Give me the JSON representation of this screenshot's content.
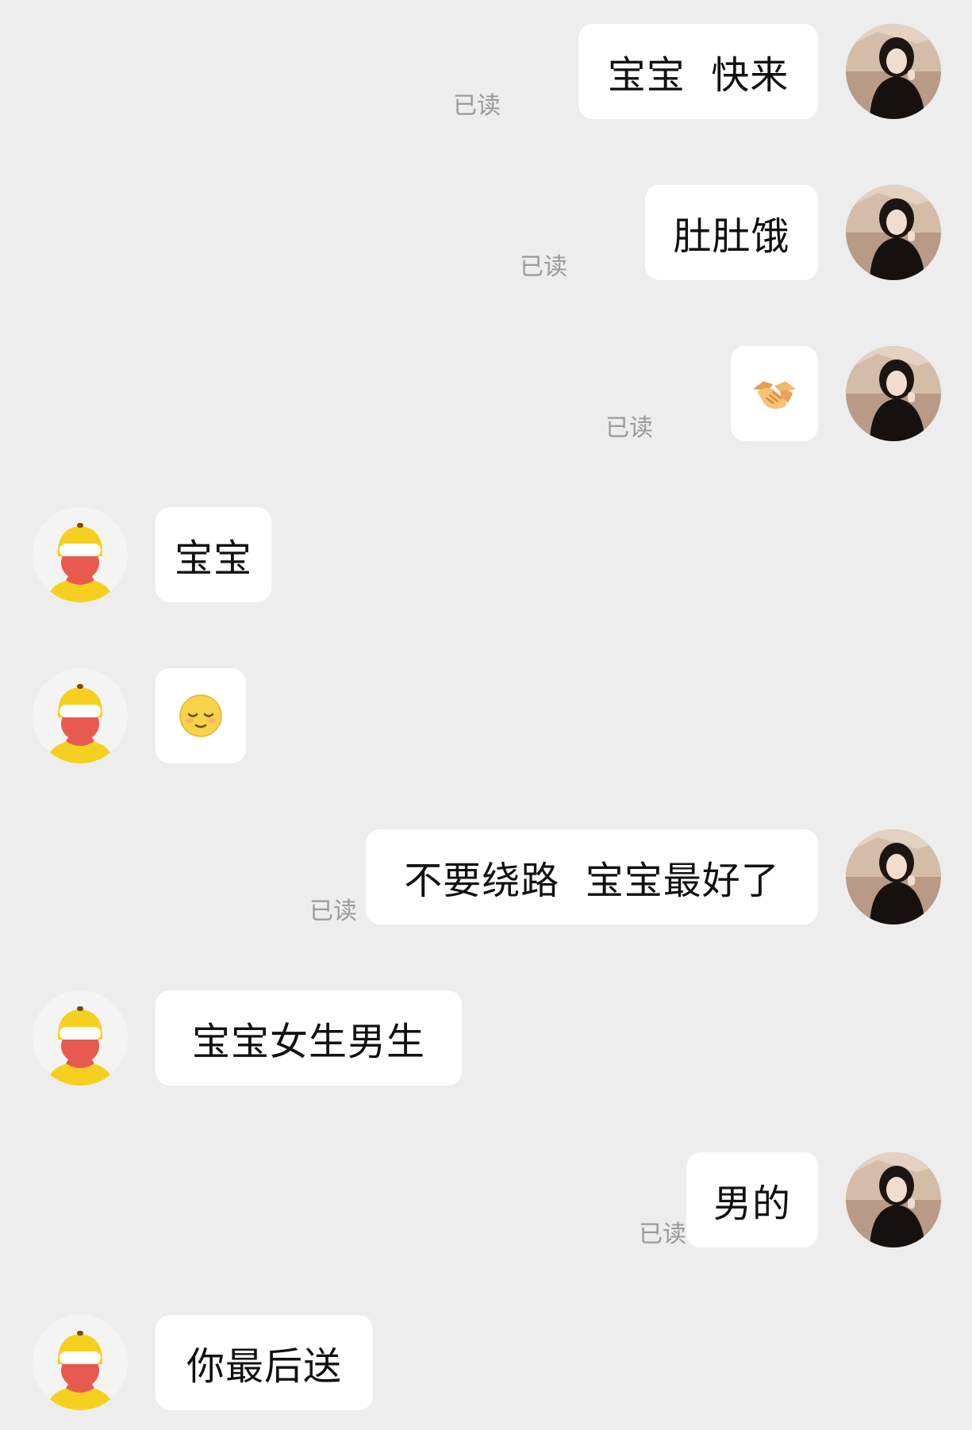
{
  "messages": [
    {
      "dir": "out",
      "text": "宝宝  快来",
      "receipt": "已读"
    },
    {
      "dir": "out",
      "text": "肚肚饿",
      "receipt": "已读"
    },
    {
      "dir": "out",
      "emoji": "handshake-icon",
      "receipt": "已读"
    },
    {
      "dir": "in",
      "text": "宝宝"
    },
    {
      "dir": "in",
      "emoji": "relieved-face-icon"
    },
    {
      "dir": "out",
      "text": "不要绕路  宝宝最好了",
      "receipt": "已读"
    },
    {
      "dir": "in",
      "text": "宝宝女生男生"
    },
    {
      "dir": "out",
      "text": "男的",
      "receipt": "已读"
    },
    {
      "dir": "in",
      "text": "你最后送"
    }
  ],
  "colors": {
    "background": "#ededed",
    "bubble": "#ffffff",
    "receipt_text": "#9a9a9a",
    "courier_helmet": "#f5d020",
    "courier_face": "#e85a4f"
  }
}
